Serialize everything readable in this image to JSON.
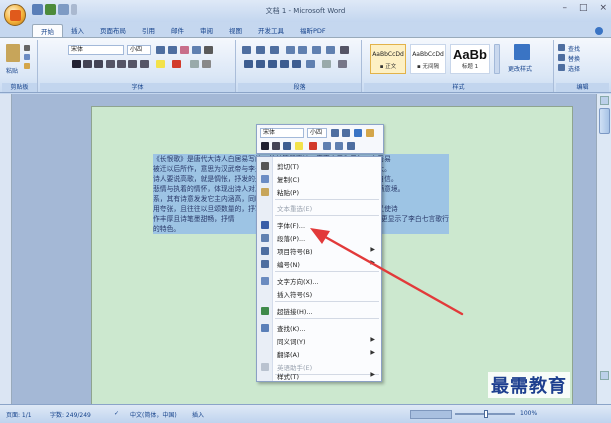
{
  "window": {
    "title": "文档 1 - Microsoft Word",
    "controls": [
      "–",
      "□",
      "×"
    ]
  },
  "tabs": [
    "开始",
    "插入",
    "页面布局",
    "引用",
    "邮件",
    "审阅",
    "视图",
    "开发工具",
    "福昕PDF"
  ],
  "ribbon": {
    "clipboard": {
      "paste": "粘贴",
      "label": "剪贴板"
    },
    "font": {
      "font_name": "宋体",
      "font_size": "小四",
      "label": "字体"
    },
    "paragraph": {
      "label": "段落"
    },
    "styles": {
      "label": "样式",
      "items": [
        {
          "sample": "AaBbCcDd",
          "name": "▪ 正文"
        },
        {
          "sample": "AaBbCcDd",
          "name": "▪ 无间隔"
        },
        {
          "sample": "AaBb",
          "name": "标题 1"
        }
      ],
      "change_styles": "更改样式"
    },
    "editing": {
      "find": "查找",
      "replace": "替换",
      "select": "选择",
      "label": "编辑"
    }
  },
  "document": {
    "lines": [
      "《长恨歌》是唐代大诗人白居易写的一首长篇叙事诗。唐宪宗元和元年，白居易",
      "被迁以后所作，意思为汉武帝与李夫人之间，也是宫闱之事，诗作中影响最大。",
      "诗人要说高歌，就是惆怅，抒发的是人与人之间的情感，歌颂了纯真美好与自信。",
      "悲情与执着的情怀，体现出诗人对真挚爱情的向往，写出了普遍的美好，充满意境。",
      "系，其有诗意发发它主内涵高，同时也对唐玄宗的荒淫误国，在手法上多",
      "用夸张，且往往以旦颂数量的，抒写了宫中的美人，通过一种委婉的情怀，又使诗",
      "作丰厚且诗笔墨甜畅，抒情"
    ],
    "line_tail": [
      "",
      "",
      "",
      "",
      "",
      "",
      "浪漫主义的风格，更显示了李白七言歌行"
    ],
    "last_line": "的特色。"
  },
  "mini_toolbar": {
    "font_name": "宋体",
    "font_size": "小四"
  },
  "context_menu": {
    "items": [
      {
        "label": "剪切(T)",
        "icon": "scissors-icon",
        "disabled": false
      },
      {
        "label": "复制(C)",
        "icon": "copy-icon",
        "disabled": false
      },
      {
        "label": "粘贴(P)",
        "icon": "paste-icon",
        "disabled": false
      },
      {
        "label": "文本重选(E)",
        "icon": "",
        "disabled": true
      },
      {
        "label": "字体(F)...",
        "icon": "font-icon",
        "disabled": false
      },
      {
        "label": "段落(P)...",
        "icon": "paragraph-icon",
        "disabled": false
      },
      {
        "label": "项目符号(B)",
        "icon": "bullets-icon",
        "disabled": false,
        "submenu": true
      },
      {
        "label": "编号(N)",
        "icon": "numbering-icon",
        "disabled": false,
        "submenu": true
      },
      {
        "label": "文字方向(X)...",
        "icon": "text-direction-icon",
        "disabled": false
      },
      {
        "label": "插入符号(S)",
        "icon": "",
        "disabled": false
      },
      {
        "label": "超链接(H)...",
        "icon": "hyperlink-icon",
        "disabled": false
      },
      {
        "label": "查找(K)...",
        "icon": "lookup-icon",
        "disabled": false
      },
      {
        "label": "同义词(Y)",
        "icon": "",
        "disabled": false,
        "submenu": true
      },
      {
        "label": "翻译(A)",
        "icon": "",
        "disabled": false,
        "submenu": true
      },
      {
        "label": "英语助手(E)",
        "icon": "assistant-icon",
        "disabled": true
      },
      {
        "label": "样式(T)",
        "icon": "",
        "disabled": false,
        "submenu": true
      }
    ]
  },
  "status": {
    "page": "页面: 1/1",
    "words": "字数: 249/249",
    "language": "中文(简体，中国)",
    "mode": "插入",
    "zoom": "100%"
  },
  "watermark": "最需教育",
  "colors": {
    "accent": "#15428b",
    "selection": "#9dc4e4",
    "page_bg": "#cce8cf",
    "arrow": "#e23a3a"
  }
}
